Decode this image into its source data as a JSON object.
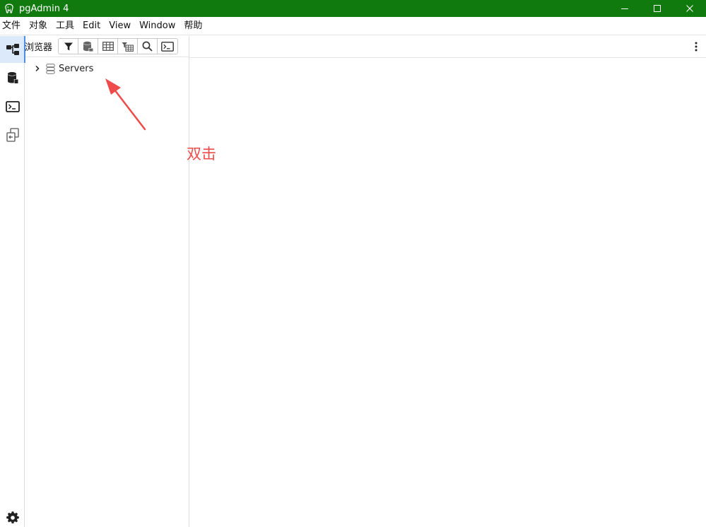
{
  "window": {
    "title": "pgAdmin 4",
    "app_icon": "elephant-icon",
    "controls": [
      "minimize-icon",
      "maximize-icon",
      "close-icon"
    ]
  },
  "menu": {
    "items": [
      "文件",
      "对象",
      "工具",
      "Edit",
      "View",
      "Window",
      "帮助"
    ]
  },
  "activity_bar": {
    "items": [
      {
        "icon": "object-explorer-icon",
        "active": true
      },
      {
        "icon": "database-icon",
        "active": false
      },
      {
        "icon": "terminal-icon",
        "active": false
      },
      {
        "icon": "schema-diff-icon",
        "active": false
      }
    ],
    "bottom": {
      "icon": "gear-icon"
    }
  },
  "browser": {
    "title": "浏览器",
    "toolbar": [
      "filter-icon",
      "query-tool-icon",
      "view-data-icon",
      "sql-table-icon",
      "search-icon",
      "psql-terminal-icon"
    ],
    "tree": [
      {
        "label": "Servers",
        "icon": "servers-icon",
        "expanded": false
      }
    ]
  },
  "main": {
    "menu_icon": "kebab-menu-icon"
  },
  "annotation": {
    "text": "双击",
    "color": "#f04b4b"
  },
  "colors": {
    "titlebar": "#117a0f",
    "active_tab_bg": "#dbe9fb",
    "active_tab_accent": "#4d8de8"
  }
}
